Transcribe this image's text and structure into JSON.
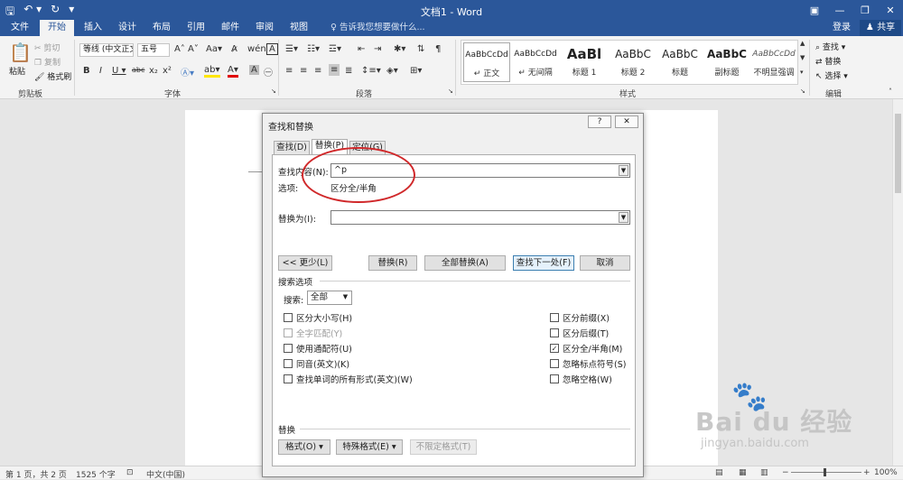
{
  "titlebar": {
    "title": "文档1 - Word"
  },
  "tabs": [
    "文件",
    "开始",
    "插入",
    "设计",
    "布局",
    "引用",
    "邮件",
    "审阅",
    "视图"
  ],
  "tell_me": "告诉我您想要做什么...",
  "login": "登录",
  "share": "共享",
  "ribbon": {
    "clipboard": {
      "paste": "粘贴",
      "cut": "剪切",
      "copy": "复制",
      "format_painter": "格式刷",
      "group": "剪贴板"
    },
    "font": {
      "font_name": "等线 (中文正文)",
      "font_size": "五号",
      "group": "字体"
    },
    "paragraph": {
      "group": "段落"
    },
    "styles": {
      "group": "样式",
      "items": [
        {
          "preview": "AaBbCcDd",
          "name": "↵ 正文"
        },
        {
          "preview": "AaBbCcDd",
          "name": "↵ 无间隔"
        },
        {
          "preview": "AaBl",
          "name": "标题 1"
        },
        {
          "preview": "AaBbC",
          "name": "标题 2"
        },
        {
          "preview": "AaBbC",
          "name": "标题"
        },
        {
          "preview": "AaBbC",
          "name": "副标题"
        },
        {
          "preview": "AaBbCcDd",
          "name": "不明显强调"
        }
      ]
    },
    "editing": {
      "find": "查找",
      "replace": "替换",
      "select": "选择",
      "group": "编辑"
    }
  },
  "dialog": {
    "title": "查找和替换",
    "help": "?",
    "close": "✕",
    "tabs": [
      "查找(D)",
      "替换(P)",
      "定位(G)"
    ],
    "find_label": "查找内容(N):",
    "find_value": "^p",
    "options_label": "选项:",
    "options_value": "区分全/半角",
    "replace_label": "替换为(I):",
    "replace_value": "",
    "buttons": {
      "less": "<< 更少(L)",
      "replace": "替换(R)",
      "replace_all": "全部替换(A)",
      "find_next": "查找下一处(F)",
      "cancel": "取消"
    },
    "search_options_title": "搜索选项",
    "search_label": "搜索:",
    "search_value": "全部",
    "left_options": [
      {
        "label": "区分大小写(H)",
        "checked": false,
        "disabled": false
      },
      {
        "label": "全字匹配(Y)",
        "checked": false,
        "disabled": true
      },
      {
        "label": "使用通配符(U)",
        "checked": false,
        "disabled": false
      },
      {
        "label": "同音(英文)(K)",
        "checked": false,
        "disabled": false
      },
      {
        "label": "查找单词的所有形式(英文)(W)",
        "checked": false,
        "disabled": false
      }
    ],
    "right_options": [
      {
        "label": "区分前缀(X)",
        "checked": false,
        "disabled": false
      },
      {
        "label": "区分后缀(T)",
        "checked": false,
        "disabled": false
      },
      {
        "label": "区分全/半角(M)",
        "checked": true,
        "disabled": false
      },
      {
        "label": "忽略标点符号(S)",
        "checked": false,
        "disabled": false
      },
      {
        "label": "忽略空格(W)",
        "checked": false,
        "disabled": false
      }
    ],
    "replace_section": "替换",
    "format_btn": "格式(O) ▾",
    "special_btn": "特殊格式(E) ▾",
    "no_format_btn": "不限定格式(T)"
  },
  "status": {
    "page": "第 1 页，共 2 页",
    "words": "1525 个字",
    "lang": "中文(中国)",
    "zoom": "100%"
  },
  "watermark": {
    "brand": "Bai du 经验",
    "url": "jingyan.baidu.com"
  }
}
